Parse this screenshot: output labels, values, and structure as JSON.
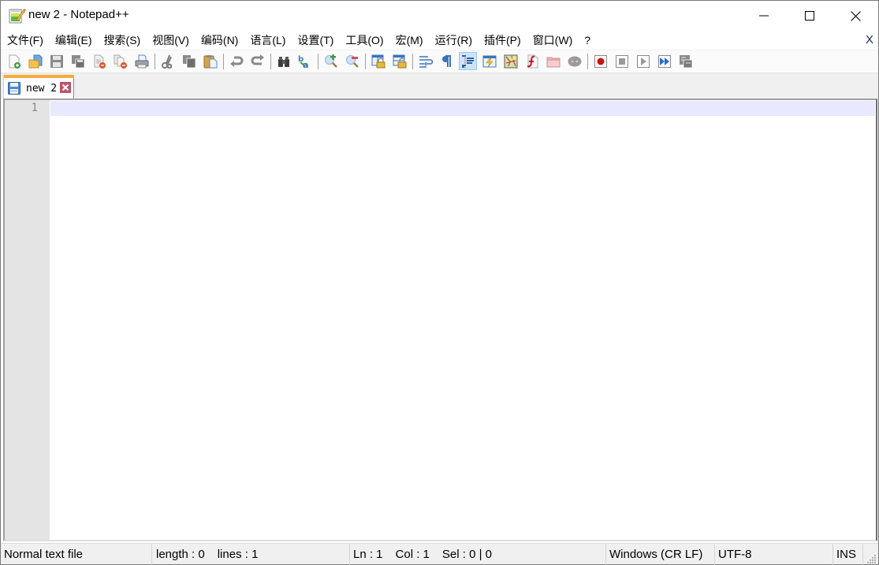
{
  "window": {
    "title": "new 2 - Notepad++",
    "controls": {
      "minimize": "minimize",
      "maximize": "maximize",
      "close": "close"
    }
  },
  "menubar": {
    "items": [
      {
        "label": "文件(F)",
        "name": "file"
      },
      {
        "label": "编辑(E)",
        "name": "edit"
      },
      {
        "label": "搜索(S)",
        "name": "search"
      },
      {
        "label": "视图(V)",
        "name": "view"
      },
      {
        "label": "编码(N)",
        "name": "encoding"
      },
      {
        "label": "语言(L)",
        "name": "language"
      },
      {
        "label": "设置(T)",
        "name": "settings"
      },
      {
        "label": "工具(O)",
        "name": "tools"
      },
      {
        "label": "宏(M)",
        "name": "macro"
      },
      {
        "label": "运行(R)",
        "name": "run"
      },
      {
        "label": "插件(P)",
        "name": "plugins"
      },
      {
        "label": "窗口(W)",
        "name": "window"
      },
      {
        "label": "?",
        "name": "help"
      }
    ],
    "close_doc_label": "X"
  },
  "toolbar": {
    "buttons": [
      "new-file",
      "open-file",
      "save",
      "save-all",
      "close",
      "close-all",
      "print",
      "|",
      "cut",
      "copy",
      "paste",
      "|",
      "undo",
      "redo",
      "|",
      "find",
      "replace",
      "|",
      "zoom-in",
      "zoom-out",
      "|",
      "sync-vertical-scroll",
      "sync-horizontal-scroll",
      "|",
      "word-wrap",
      "show-all-characters",
      "indent-guide",
      "user-defined-language",
      "document-map",
      "function-list",
      "folder-as-workspace",
      "monitoring",
      "|",
      "start-recording",
      "stop-recording",
      "playback",
      "run-macro-multiple",
      "save-macro"
    ],
    "active": "indent-guide"
  },
  "tabs": [
    {
      "label": "new 2",
      "active": true,
      "unsaved": false
    }
  ],
  "editor": {
    "line_numbers": [
      "1"
    ],
    "content": "",
    "current_line_color": "#e8e8ff"
  },
  "statusbar": {
    "file_type": "Normal text file",
    "length": "length : 0",
    "lines": "lines : 1",
    "ln": "Ln : 1",
    "col": "Col : 1",
    "sel": "Sel : 0 | 0",
    "eol": "Windows (CR LF)",
    "encoding": "UTF-8",
    "mode": "INS"
  },
  "colors": {
    "tab_accent": "#fbaa3b",
    "gutter": "#e4e4e4",
    "current_line": "#e8e8ff",
    "tab_close": "#c0506a"
  }
}
